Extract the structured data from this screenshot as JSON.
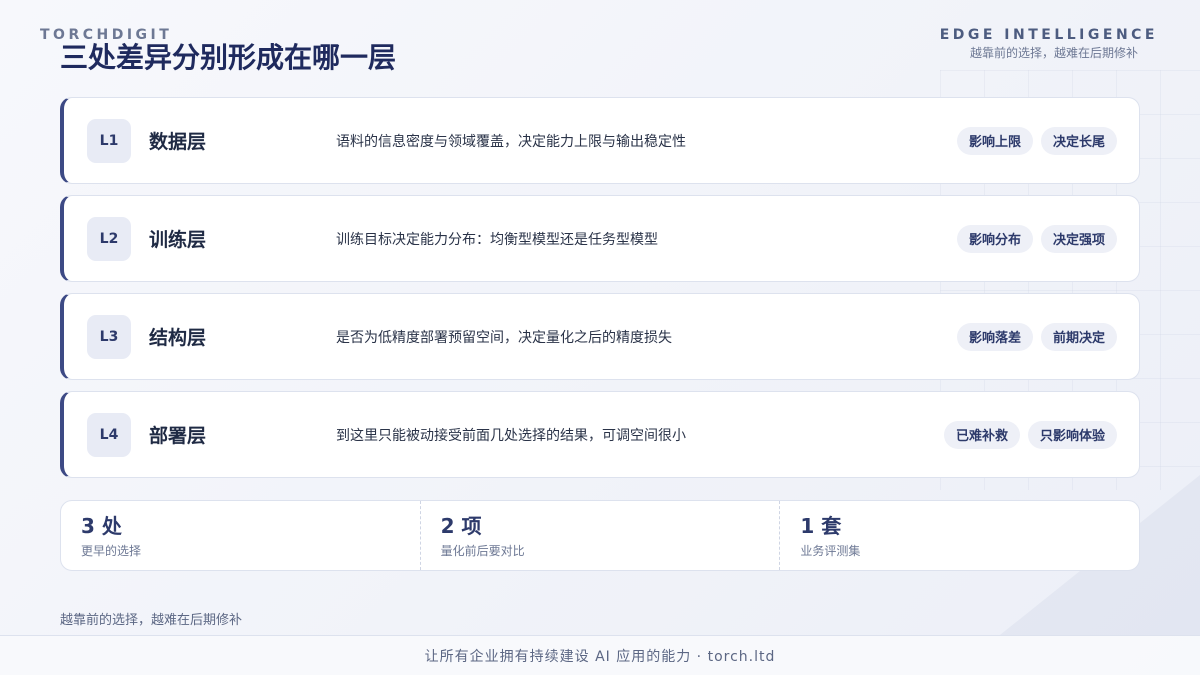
{
  "header": {
    "brand": "TORCHDIGIT",
    "title": "三处差异分别形成在哪一层",
    "tag_en": "EDGE INTELLIGENCE",
    "tag_cn": "越靠前的选择，越难在后期修补"
  },
  "layers": [
    {
      "code": "L1",
      "name": "数据层",
      "desc": "语料的信息密度与领域覆盖，决定能力上限与输出稳定性",
      "tags": [
        "影响上限",
        "决定长尾"
      ]
    },
    {
      "code": "L2",
      "name": "训练层",
      "desc": "训练目标决定能力分布：均衡型模型还是任务型模型",
      "tags": [
        "影响分布",
        "决定强项"
      ]
    },
    {
      "code": "L3",
      "name": "结构层",
      "desc": "是否为低精度部署预留空间，决定量化之后的精度损失",
      "tags": [
        "影响落差",
        "前期决定"
      ]
    },
    {
      "code": "L4",
      "name": "部署层",
      "desc": "到这里只能被动接受前面几处选择的结果，可调空间很小",
      "tags": [
        "已难补救",
        "只影响体验"
      ]
    }
  ],
  "stats": [
    {
      "value": "3 处",
      "label": "更早的选择"
    },
    {
      "value": "2 项",
      "label": "量化前后要对比"
    },
    {
      "value": "1 套",
      "label": "业务评测集"
    }
  ],
  "note": "越靠前的选择，越难在后期修补",
  "footer": "让所有企业拥有持续建设 AI 应用的能力 · torch.ltd",
  "colors": {
    "accent": "#3d4a85",
    "title": "#1f2a5e"
  }
}
